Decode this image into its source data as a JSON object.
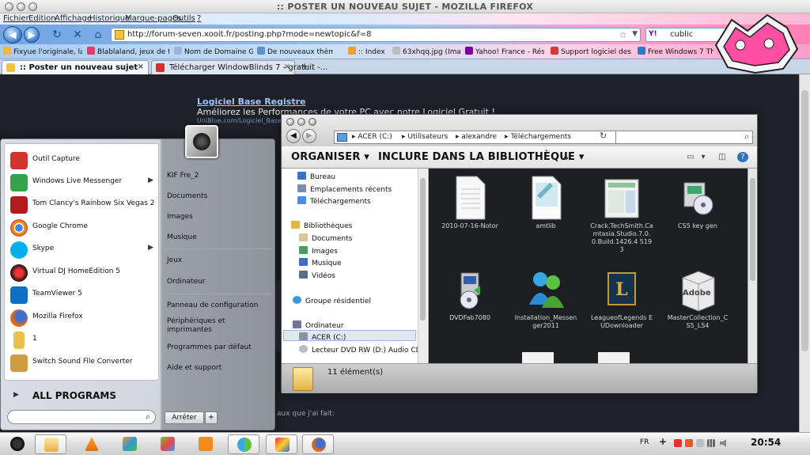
{
  "firefox": {
    "title": ":: POSTER UN NOUVEAU SUJET - MOZILLA FIREFOX",
    "menu": [
      "Fichier",
      "Edition",
      "Affichage",
      "Historique",
      "Marque-pages",
      "Outils",
      "?"
    ],
    "url": "http://forum-seven.xooit.fr/posting.php?mode=newtopic&f=8",
    "search_engine": "Y!",
    "search_text": "cublic",
    "bookmarks": [
      "Fixyue l'originale, la b...",
      "Blablaland, jeux de tc...",
      "Nom de Domaine GRA...",
      "De nouveaux thèmes ...",
      ":: Index",
      "63xhqq.jpg (Image JP...",
      "Yahoo! France - Résult...",
      "Support logiciel des fo...",
      "Free Windows 7 Them..."
    ],
    "tabs": [
      {
        "label": ":: Poster un nouveau sujet"
      },
      {
        "label": "Télécharger WindowBlinds 7 - gratuit -..."
      }
    ],
    "new_tab": "+",
    "tab_close": "×"
  },
  "page": {
    "ad_link": "Logiciel Base Registre",
    "ad_desc": "Améliorez les Performances de votre PC avec notre Logiciel Gratuit !",
    "ad_url": "UniBlue.com/Logiciel_Base_R...",
    "snippet": "aux que j'ai fait:"
  },
  "explorer": {
    "breadcrumbs": [
      "ACER (C:)",
      "Utilisateurs",
      "alexandre",
      "Téléchargements"
    ],
    "commands": [
      "ORGANISER",
      "INCLURE DANS LA BIBLIOTHÈQUE",
      "»"
    ],
    "nav": {
      "favorites": [
        "Bureau",
        "Emplacements récents",
        "Téléchargements"
      ],
      "libraries_header": "Bibliothèques",
      "libraries": [
        "Documents",
        "Images",
        "Musique",
        "Vidéos"
      ],
      "homegroup": "Groupe résidentiel",
      "computer_header": "Ordinateur",
      "drives": [
        "ACER (C:)",
        "Lecteur DVD RW (D:) Audio CD"
      ]
    },
    "files": [
      {
        "name": "2010-07-16-Notor",
        "icon": "text-file-icon"
      },
      {
        "name": "amtlib",
        "icon": "notepad-file-icon"
      },
      {
        "name": "Crack.TechSmith.Camtasia.Studio.7.0.0.Build.1426.4 5193",
        "icon": "document-file-icon"
      },
      {
        "name": "CS5 key gen",
        "icon": "installer-icon"
      },
      {
        "name": "DVDFab7080",
        "icon": "installer-icon"
      },
      {
        "name": "Installation_Messenger2011",
        "icon": "messenger-icon"
      },
      {
        "name": "LeagueofLegends EUDownloader",
        "icon": "league-icon"
      },
      {
        "name": "MasterCollection_CS5_LS4",
        "icon": "adobe-box-icon"
      }
    ],
    "adobe_box_text": "Adobe",
    "status": "11 élément(s)"
  },
  "start_menu": {
    "programs": [
      {
        "label": "Outil Capture",
        "color": "#d0342c",
        "arrow": false
      },
      {
        "label": "Windows Live Messenger",
        "color": "#36a34b",
        "arrow": true
      },
      {
        "label": "Tom Clancy's Rainbow Six Vegas 2",
        "color": "#b01b1b",
        "arrow": false
      },
      {
        "label": "Google Chrome",
        "color": "#f2b705",
        "arrow": false
      },
      {
        "label": "Skype",
        "color": "#00aff0",
        "arrow": true
      },
      {
        "label": "Virtual DJ HomeEdition 5",
        "color": "#c21f1f",
        "arrow": false
      },
      {
        "label": "TeamViewer 5",
        "color": "#0e6fc4",
        "arrow": false
      },
      {
        "label": "Mozilla Firefox",
        "color": "#e66a10",
        "arrow": false
      },
      {
        "label": "1",
        "color": "#e9c04c",
        "arrow": false
      },
      {
        "label": "Switch Sound File Converter",
        "color": "#cf9d3d",
        "arrow": false
      }
    ],
    "all_programs": "ALL PROGRAMS",
    "right_items": [
      "KIF Fre_2",
      "Documents",
      "Images",
      "Musique",
      "Jeux",
      "Ordinateur",
      "Panneau de configuration",
      "Périphériques et imprimantes",
      "Programmes par défaut",
      "Aide et support"
    ],
    "shutdown": "Arrêter",
    "shutdown_more": "+"
  },
  "taskbar": {
    "lang": "FR",
    "plus": "+",
    "clock": "20:54"
  }
}
